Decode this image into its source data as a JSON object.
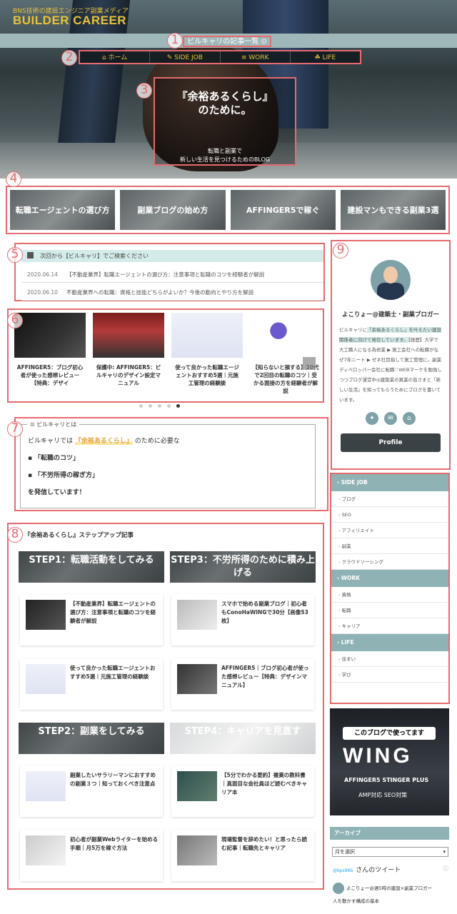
{
  "site": {
    "tagline": "BNS技術の建設エンジニア副業メディア",
    "logo": "BUILDER CAREER"
  },
  "topbar": {
    "link": "ビルキャリの記事一覧 ⊙"
  },
  "nav": {
    "items": [
      "⌂ ホーム",
      "✎ SIDE JOB",
      "≡ WORK",
      "☘ LIFE"
    ]
  },
  "hero": {
    "line1": "『余裕あるくらし』",
    "line2": "のために。",
    "sub1": "転職と副業で",
    "sub2": "新しい生活を見つけるためのBLOG"
  },
  "categories": [
    "転職エージェントの選び方",
    "副業ブログの始め方",
    "AFFINGER5で稼ぐ",
    "建設マンもできる副業3選"
  ],
  "news": {
    "header": "次回から【ビルキャリ】でご検索ください",
    "rows": [
      {
        "date": "2020.06.14",
        "text": "【不動産業界】転職エージェントの選び方：注意事項と転職のコツを経験者が解説"
      },
      {
        "date": "2020.06.10",
        "text": "不動産業界への転職：資格と技能どちらがよいか？今後の動向とやり方を解説"
      }
    ]
  },
  "carousel": [
    {
      "title": "AFFINGER5：ブログ初心者が使った感想レビュー【特典：デザイ"
    },
    {
      "title": "保護中: AFFINGER5：ビルキャリのデザイン設定マニュアル"
    },
    {
      "title": "使って良かった転職エージェントおすすめ5選｜元施工管理の経験談"
    },
    {
      "title": "【知らないと損する】20代で2回目の転職のコツ｜受かる面接の方を経験者が解説"
    }
  ],
  "about": {
    "label": "ビルキャリとは",
    "line1a": "ビルキャリでは",
    "line1b": "『余裕あるくらし』",
    "line1c": "のために必要な",
    "item1": "「転職のコツ」",
    "item2": "「不労所得の稼ぎ方」",
    "line2": "を発信しています！"
  },
  "steps": {
    "title": "『余裕あるくらし』ステップアップ記事",
    "headers": [
      "STEP1：転職活動をしてみる",
      "STEP3：不労所得のために積み上げる",
      "STEP2：副業をしてみる",
      "STEP4：キャリアを見直す"
    ],
    "cards": [
      "【不動産業界】転職エージェントの選び方：注意事項と転職のコツを経験者が解説",
      "スマホで始める副業ブログ｜初心者もConoHaWINGで30分【画像53枚】",
      "使って良かった転職エージェントおすすめ5選｜元施工管理の経験談",
      "AFFINGER5｜ブログ初心者が使った感想レビュー【特典：デザインマニュアル】",
      "副業したいサラリーマンにおすすめの副業３つ｜知っておくべき注意点",
      "【5分でわかる要約】複業の教科書｜真面目な会社員ほど読むべきキャリア本",
      "初心者が副業Webライターを始める手順｜月5万を稼ぐ方法",
      "現場監督を辞めたい！と思ったら読む記事｜転職先とキャリア"
    ]
  },
  "profile": {
    "name": "よこりょー@建築士・副業ブロガー",
    "bio_pre": "ビルキャリに",
    "bio_hl": "「余裕あるくらし」を叶えたい建設関係者に向けて発信しています。",
    "bio_post": "【経歴】大学で大工職人になる為修業 ▶ 施工会社への転職がなぜ7年ニート ▶ ゼネ社目指して施工管理に。副業ディベロッパー会社に転職♡WEBマーケを勉強しつつブログ運営中◎建築業の異業の皆さまと「新しい生活」を知ってもらうためにブログを書いています。",
    "button": "Profile"
  },
  "menu": {
    "sections": [
      {
        "title": "SIDE JOB",
        "items": [
          "ブログ",
          "SEO",
          "アフィリエイト",
          "副業",
          "クラウドソーシング"
        ]
      },
      {
        "title": "WORK",
        "items": [
          "資格",
          "転職",
          "キャリア"
        ]
      },
      {
        "title": "LIFE",
        "items": [
          "住まい",
          "学び"
        ]
      }
    ]
  },
  "banner": {
    "caption": "このブログで使ってます",
    "word": "WING",
    "line1": "AFFINGER5 STINGER PLUS",
    "line2": "AMP対応 SEO対策"
  },
  "archive": {
    "title": "アーカイブ",
    "select": "月を選択"
  },
  "twitter": {
    "handle": "@bps96b",
    "title": "さんのツイート",
    "user": "よこりょー@週5時の建設×副業ブロガー",
    "text": "人を動かす構成の基本"
  },
  "annotations": [
    "1",
    "2",
    "3",
    "4",
    "5",
    "6",
    "7",
    "8",
    "9"
  ]
}
